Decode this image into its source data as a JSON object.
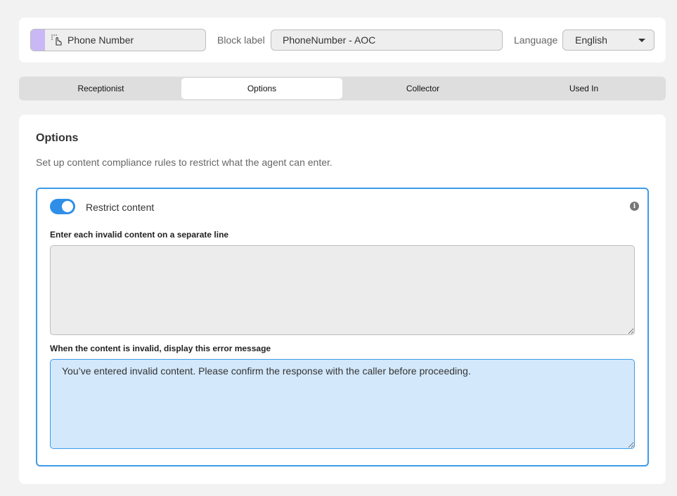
{
  "header": {
    "block_name": "Phone Number",
    "block_label_caption": "Block label",
    "block_label_value": "PhoneNumber - AOC",
    "language_caption": "Language",
    "language_value": "English",
    "chip_icon": "drag-hand-icon",
    "chip_accent": "#c9b8f5"
  },
  "tabs": [
    {
      "label": "Receptionist",
      "active": false
    },
    {
      "label": "Options",
      "active": true
    },
    {
      "label": "Collector",
      "active": false
    },
    {
      "label": "Used In",
      "active": false
    }
  ],
  "options": {
    "title": "Options",
    "description": "Set up content compliance rules to restrict what the agent can enter.",
    "restrict_toggle": {
      "label": "Restrict content",
      "on": true,
      "color": "#2f8fe8"
    },
    "info_icon": "info-icon",
    "invalid_content": {
      "label": "Enter each invalid content on a separate line",
      "value": ""
    },
    "error_message": {
      "label": "When the content is invalid, display this error message",
      "value": "You’ve entered invalid content. Please confirm the response with the caller before proceeding."
    }
  },
  "colors": {
    "accent": "#3d9be9",
    "focused_field_bg": "#d3e8fb"
  }
}
